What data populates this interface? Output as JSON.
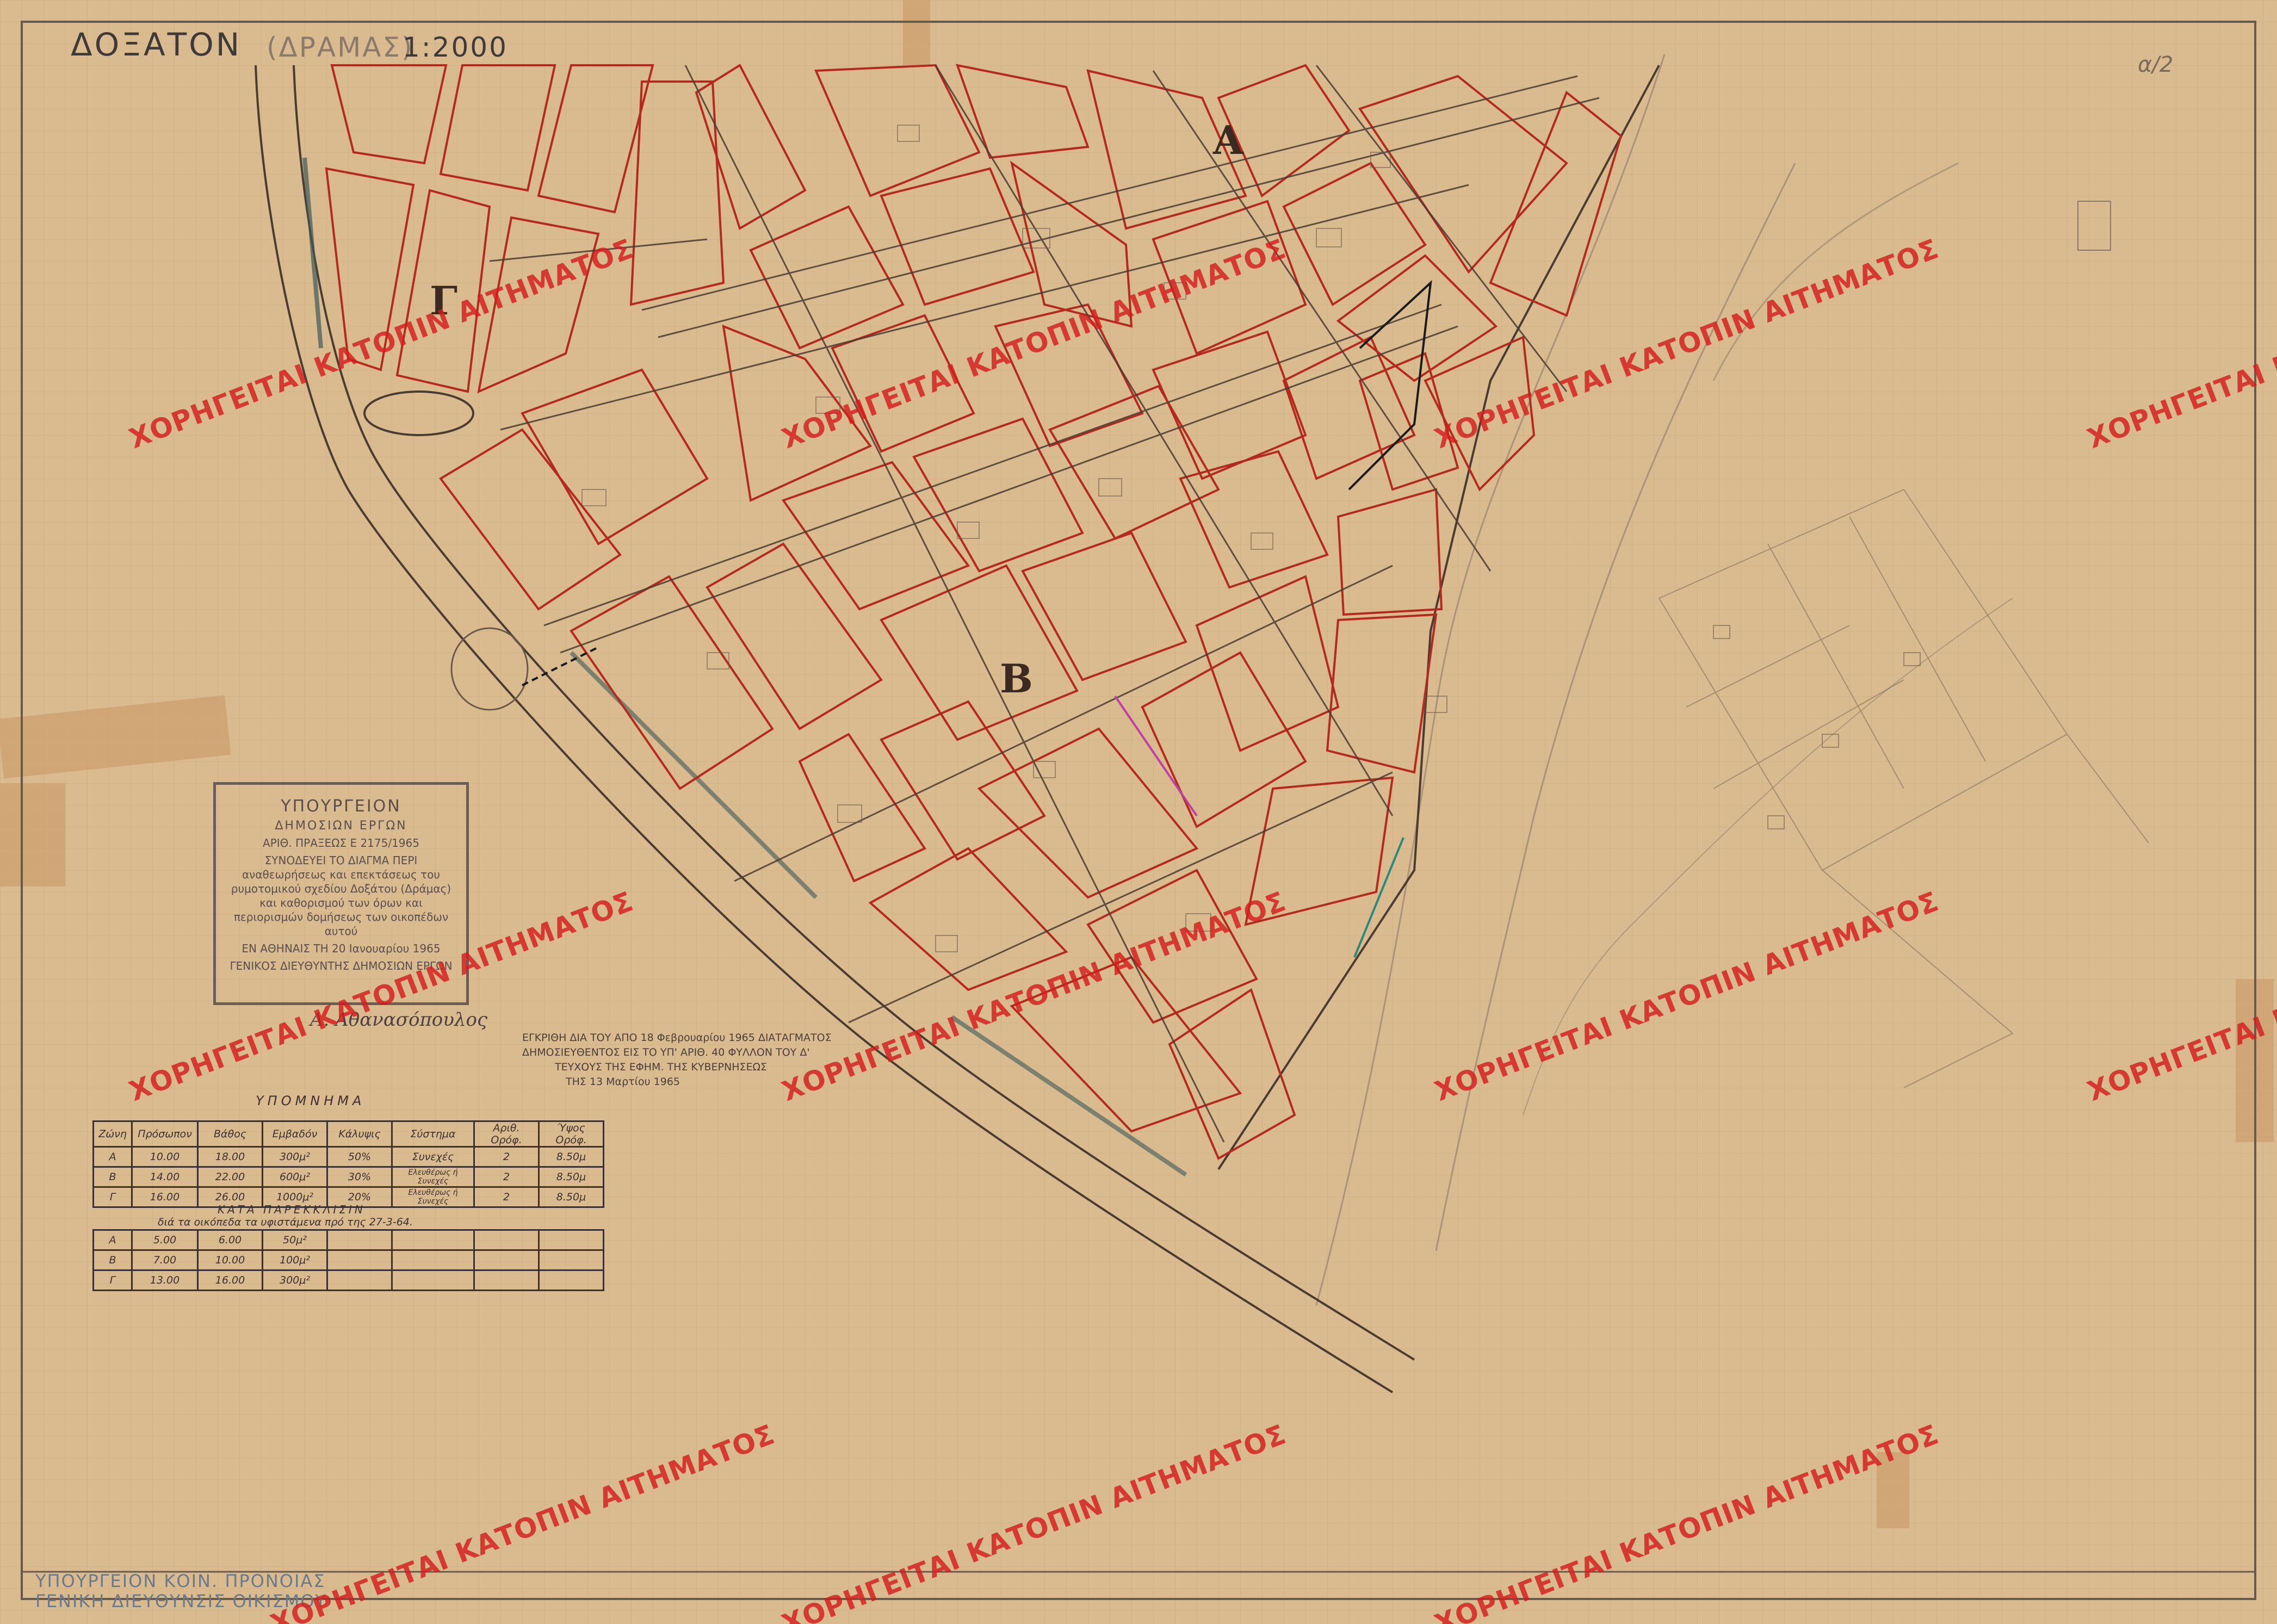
{
  "header": {
    "title": "ΔΟΞΑΤΟΝ",
    "subtitle": "(ΔΡΑΜΑΣ)",
    "scale": "1:2000",
    "sheet_number": "α/2"
  },
  "zones": {
    "a": "Α",
    "b": "Β",
    "g": "Γ"
  },
  "watermark": {
    "text": "ΧΟΡΗΓΕΙΤΑΙ ΚΑΤΟΠΙΝ ΑΙΤΗΜΑΤΟΣ",
    "color": "#d61c1c"
  },
  "stamp": {
    "line1": "ΥΠΟΥΡΓΕΙΟΝ",
    "line2": "ΔΗΜΟΣΙΩΝ ΕΡΓΩΝ",
    "line3": "ΑΡΙΘ. ΠΡΑΞΕΩΣ Ε 2175/1965",
    "line4": "ΣΥΝΟΔΕΥΕΙ ΤΟ ΔΙΑΓΜΑ ΠΕΡΙ αναθεωρήσεως και επεκτάσεως του ρυμοτομικού σχεδίου Δοξάτου (Δράμας) και καθορισμού των όρων και περιορισμών δομήσεως των οικοπέδων αυτού",
    "line5": "ΕΝ ΑΘΗΝΑΙΣ ΤΗ 20 Ιανουαρίου 1965",
    "line6": "ΓΕΝΙΚΟΣ ΔΙΕΥΘΥΝΤΗΣ ΔΗΜΟΣΙΩΝ ΕΡΓΩΝ"
  },
  "signature": "Α. Αθανασόπουλος",
  "approval": {
    "line1": "ΕΓΚΡΙΘΗ ΔΙΑ ΤΟΥ ΑΠΟ 18 Φεβρουαρίου 1965 ΔΙΑΤΑΓΜΑΤΟΣ",
    "line2": "ΔΗΜΟΣΙΕΥΘΕΝΤΟΣ ΕΙΣ ΤΟ ΥΠ' ΑΡΙΘ. 40 ΦΥΛΛΟΝ ΤΟΥ Δ'",
    "line3": "ΤΕΥΧΟΥΣ ΤΗΣ ΕΦΗΜ. ΤΗΣ ΚΥΒΕΡΝΗΣΕΩΣ",
    "line4": "ΤΗΣ 13 Μαρτίου 1965"
  },
  "legend": {
    "title": "ΥΠΟΜΝΗΜΑ",
    "headers": [
      "Ζώνη",
      "Πρόσωπον",
      "Βάθος",
      "Εμβαδόν",
      "Κάλυψις",
      "Σύστημα",
      "Αριθ. Ορόφ.",
      "Ύψος Ορόφ."
    ],
    "rows": [
      [
        "Α",
        "10.00",
        "18.00",
        "300μ²",
        "50%",
        "Συνεχές",
        "2",
        "8.50μ"
      ],
      [
        "Β",
        "14.00",
        "22.00",
        "600μ²",
        "30%",
        "Ελευθέρως ή Συνεχές",
        "2",
        "8.50μ"
      ],
      [
        "Γ",
        "16.00",
        "26.00",
        "1000μ²",
        "20%",
        "Ελευθέρως ή Συνεχές",
        "2",
        "8.50μ"
      ]
    ],
    "note_title": "ΚΑΤΑ ΠΑΡΕΚΚΛΙΣΙΝ",
    "note_text": "διά τα οικόπεδα τα υφιστάμενα πρό της 27-3-64.",
    "deviation_rows": [
      [
        "Α",
        "5.00",
        "6.00",
        "50μ²"
      ],
      [
        "Β",
        "7.00",
        "10.00",
        "100μ²"
      ],
      [
        "Γ",
        "13.00",
        "16.00",
        "300μ²"
      ]
    ]
  },
  "footer": {
    "ministry_line1": "ΥΠΟΥΡΓΕΙΟΝ ΚΟΙΝ. ΠΡΟΝΟΙΑΣ",
    "ministry_line2": "ΓΕΝΙΚΗ ΔΙΕΥΘΥΝΣΙΣ ΟΙΚΙΣΜΟΥ"
  },
  "colors": {
    "paper": "#d9bb8f",
    "block_outline": "#b42a1e",
    "street_line": "#5a4a3c",
    "stamp_ink": "#6b5c58"
  }
}
